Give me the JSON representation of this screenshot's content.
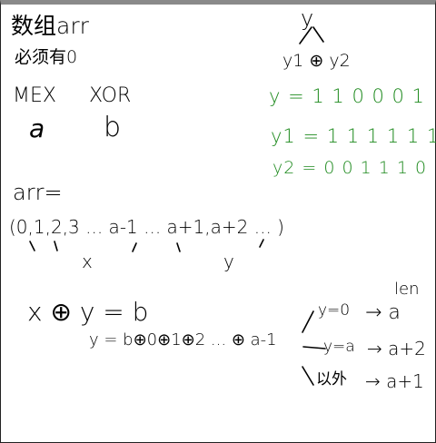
{
  "notes": {
    "title_line1": "数组arr",
    "title_line2": "必须有0",
    "mex": "MEX",
    "xor": "XOR",
    "a": "a",
    "b": "b",
    "arr_label": "arr=",
    "arr_seq": "(0,1,2,3 ... a-1 ... a+1,a+2 ... )",
    "mark_x": "x",
    "mark_y": "y",
    "eq_main": "x ⊕ y = b",
    "eq_y": "y = b⊕0⊕1⊕2 ... ⊕ a-1",
    "len_label": "len",
    "case1_cond": "y=0",
    "case1_res": "→ a",
    "case2_cond": "y=a",
    "case2_res": "→ a+2",
    "case3_cond": "以外",
    "case3_res": "→ a+1"
  },
  "tree": {
    "root": "y",
    "children": "y1 ⊕ y2"
  },
  "bits": {
    "y": "y = 1 1 0 0 0 1",
    "y1": "y1 = 1 1 1 1 1 1",
    "y2": "y2 = 0 0 1 1 1 0",
    "color": "#1e8a1e"
  }
}
